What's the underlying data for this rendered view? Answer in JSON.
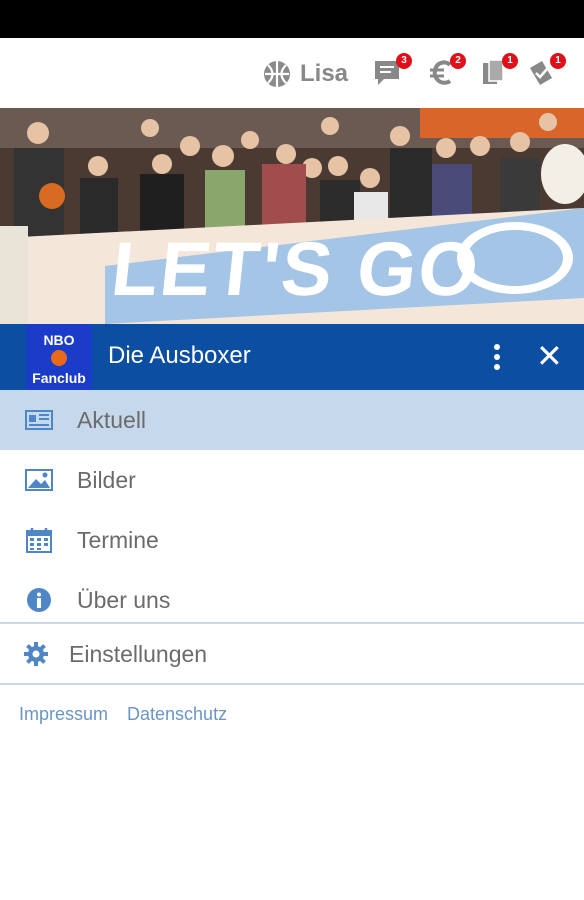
{
  "topbar": {
    "user_name": "Lisa",
    "badges": {
      "messages": "3",
      "payments": "2",
      "documents": "1",
      "tasks": "1"
    }
  },
  "hero": {
    "banner_text": "LET'S GO"
  },
  "appbar": {
    "logo_top": "NBO",
    "logo_bottom": "Fanclub",
    "title": "Die Ausboxer",
    "close_label": "✕"
  },
  "nav": {
    "items": [
      {
        "label": "Aktuell",
        "icon": "newspaper-icon",
        "active": true
      },
      {
        "label": "Bilder",
        "icon": "image-icon",
        "active": false
      },
      {
        "label": "Termine",
        "icon": "calendar-icon",
        "active": false
      },
      {
        "label": "Über uns",
        "icon": "info-icon",
        "active": false
      }
    ],
    "settings_label": "Einstellungen"
  },
  "footer": {
    "links": [
      "Impressum",
      "Datenschutz"
    ]
  },
  "colors": {
    "appbar": "#0b4ea2",
    "logo_bg": "#1a3cc8",
    "active_row": "#c6d8eb",
    "icon_blue": "#4f86c6",
    "link": "#6a95c4",
    "badge": "#e0101a"
  }
}
